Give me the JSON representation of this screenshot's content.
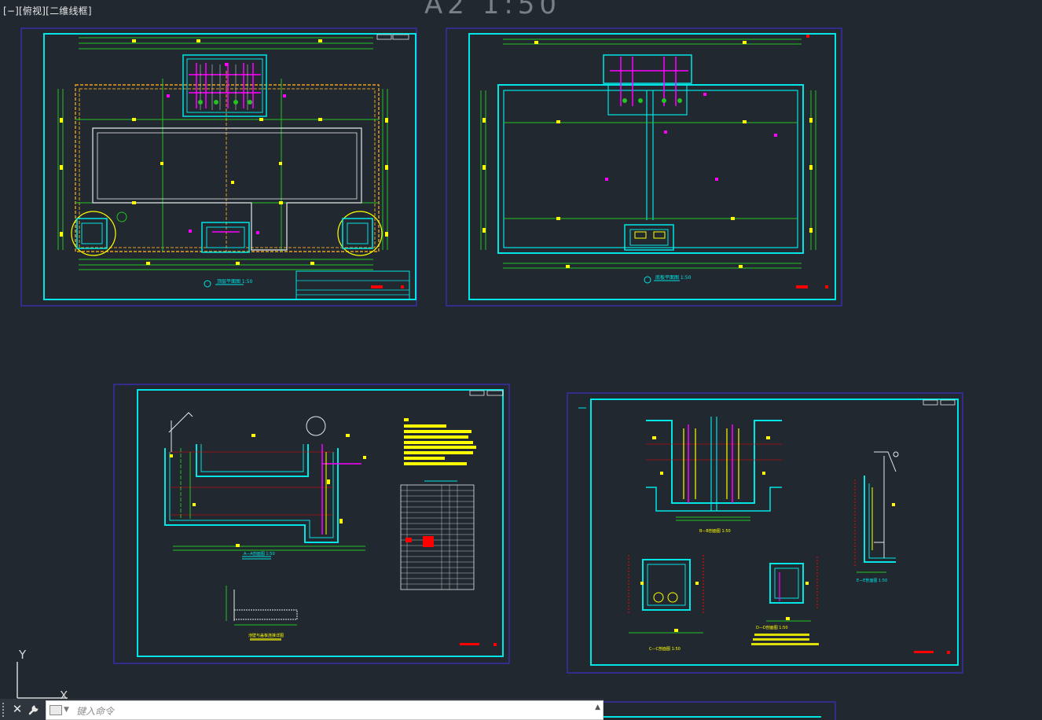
{
  "viewport": {
    "label": "[−][俯视][二维线框]",
    "bg": "#212830"
  },
  "sheet_title": "A2  1:50",
  "ucs": {
    "y_label": "Y",
    "x_label": "X"
  },
  "command_line": {
    "placeholder": "键入命令",
    "close_icon": "close-icon",
    "customize_icon": "wrench-icon"
  },
  "colors": {
    "frame_outer": "#3d2aa8",
    "frame_inner": "#00e5e5",
    "green": "#22c322",
    "yellow": "#ffff00",
    "magenta": "#ff00ff",
    "orange": "#e8a020",
    "white": "#e8e8e8",
    "red": "#ff0000"
  },
  "sheets": [
    {
      "name": "top-plan",
      "scale_label": "顶层平面图  1:50"
    },
    {
      "name": "bottom-plan",
      "scale_label": "底板平面图  1:50"
    },
    {
      "name": "section-a",
      "scale_label": "A—A剖面图  1:50",
      "detail_label": "池壁与盖板连接详图"
    },
    {
      "name": "section-b",
      "scale_label": "B—B剖面图  1:50",
      "labels": [
        "C—C剖面图  1:50",
        "D—D剖面图  1:50",
        "E—E剖面图  1:50"
      ]
    }
  ]
}
